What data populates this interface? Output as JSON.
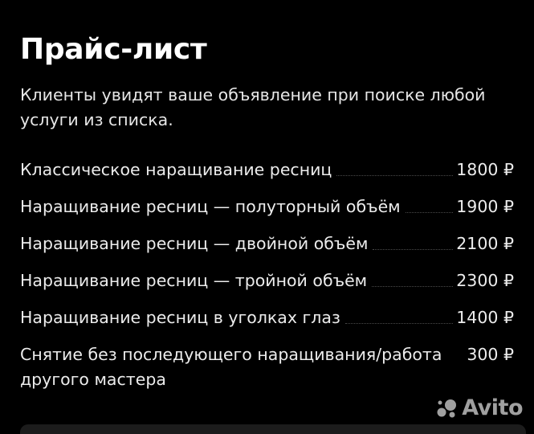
{
  "header": {
    "title": "Прайс-лист",
    "subtitle": "Клиенты увидят ваше объявление при поиске любой услуги из списка."
  },
  "price_list": {
    "items": [
      {
        "name": "Классическое наращивание ресниц",
        "price": "1800 ₽"
      },
      {
        "name": "Наращивание ресниц — полуторный объём",
        "price": "1900 ₽"
      },
      {
        "name": "Наращивание ресниц — двойной объём",
        "price": "2100 ₽"
      },
      {
        "name": "Наращивание ресниц — тройной объём",
        "price": "2300 ₽"
      },
      {
        "name": "Наращивание ресниц в уголках глаз",
        "price": "1400 ₽"
      },
      {
        "name": "Снятие без последующего наращивания/работа другого мастера",
        "price": "300 ₽"
      }
    ]
  },
  "watermark": {
    "text": "Avito",
    "icon": "avito-logo-icon"
  },
  "colors": {
    "background": "#000000",
    "text": "#ffffff",
    "card": "#1c1c1c"
  }
}
